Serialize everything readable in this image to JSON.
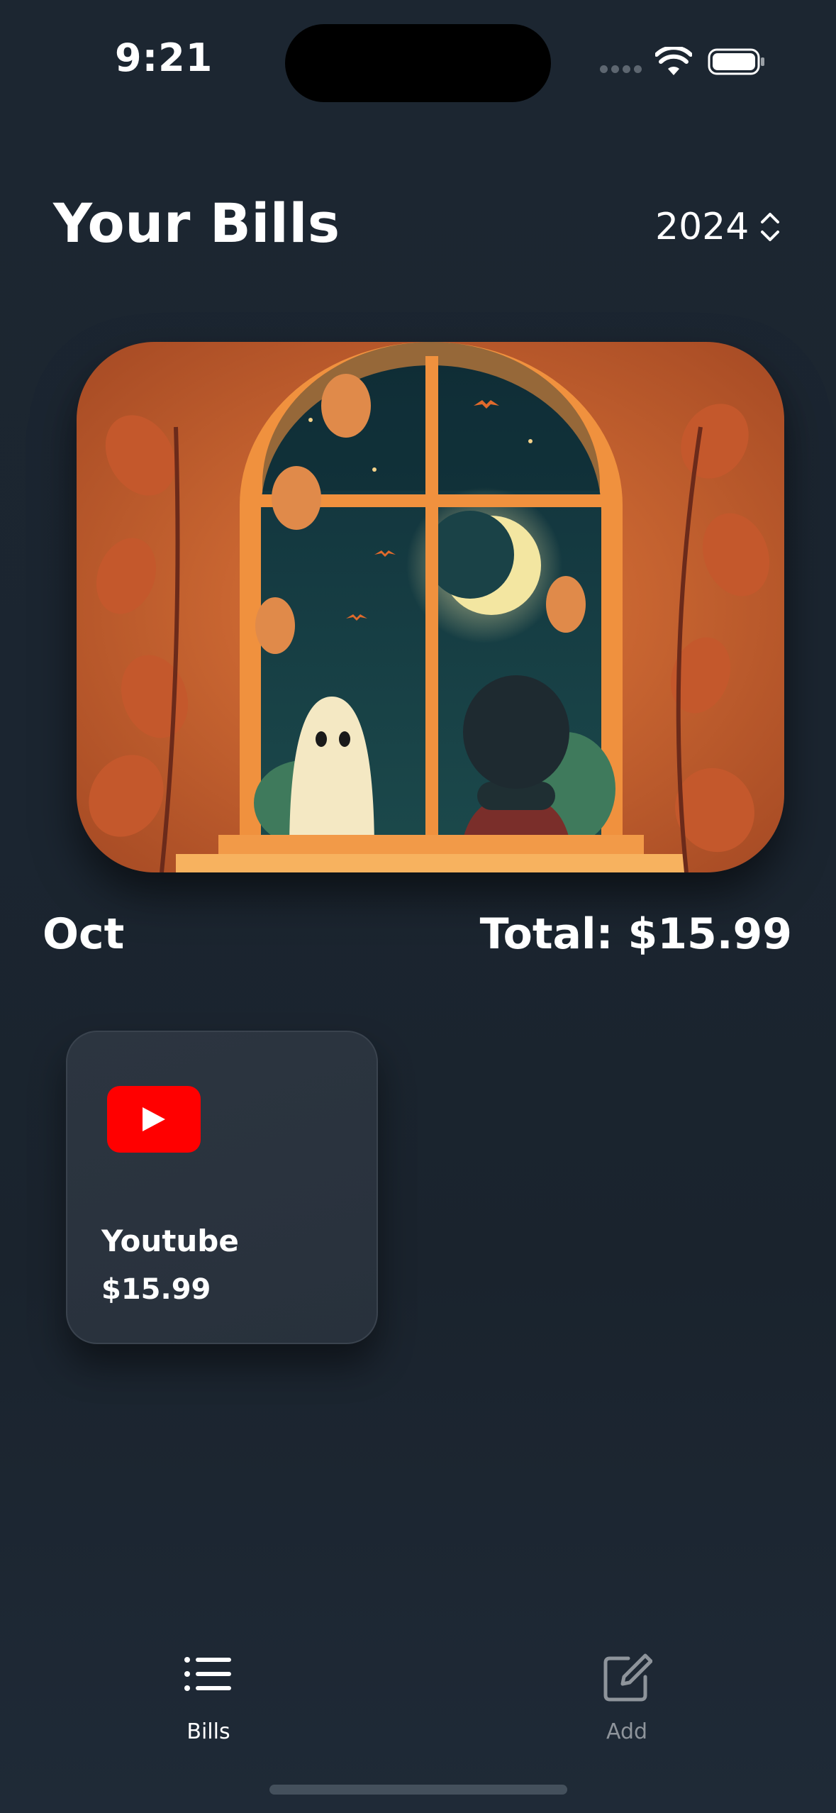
{
  "status_bar": {
    "time": "9:21"
  },
  "header": {
    "title": "Your Bills",
    "year": "2024"
  },
  "banner": {
    "description_icon": "halloween-window-illustration"
  },
  "summary": {
    "month": "Oct",
    "total": "Total: $15.99"
  },
  "bills": [
    {
      "name": "Youtube",
      "amount": "$15.99",
      "icon": "youtube-logo"
    }
  ],
  "tab_bar": {
    "tabs": [
      {
        "label": "Bills",
        "icon": "list-icon",
        "active": true
      },
      {
        "label": "Add",
        "icon": "compose-icon",
        "active": false
      }
    ]
  },
  "colors": {
    "background": "#1b2530",
    "card": "#2c3540",
    "youtube_red": "#ff0000",
    "inactive_tab": "#8e949b"
  }
}
